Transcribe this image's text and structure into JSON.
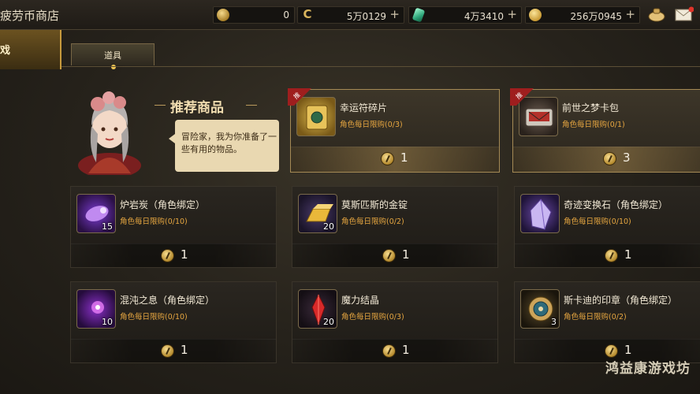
{
  "header": {
    "title": "疲劳币商店",
    "resources": [
      {
        "icon": "fatigue-coin-icon",
        "value": "0"
      },
      {
        "icon": "gold-c-icon",
        "value": "5万0129"
      },
      {
        "icon": "green-gem-icon",
        "value": "4万3410"
      },
      {
        "icon": "gold-coin-icon",
        "value": "256万0945"
      }
    ],
    "plus": "+"
  },
  "side_tab": {
    "label": "戏"
  },
  "tabs": [
    {
      "label": "道具"
    }
  ],
  "recommend": {
    "title": "推荐商品",
    "npc_speech": "冒险家，我为你准备了一些有用的物品。"
  },
  "items": [
    {
      "name": "幸运符碎片",
      "limit": "角色每日限购(0/3)",
      "price": "1",
      "qty": "",
      "featured": true,
      "icon": "lucky-charm-icon"
    },
    {
      "name": "前世之梦卡包",
      "limit": "角色每日限购(0/1)",
      "price": "3",
      "qty": "",
      "featured": true,
      "icon": "card-pack-icon"
    },
    {
      "name": "炉岩炭（角色绑定）",
      "limit": "角色每日限购(0/10)",
      "price": "1",
      "qty": "15",
      "featured": false,
      "icon": "purple-ore-icon"
    },
    {
      "name": "莫斯匹斯的金锭",
      "limit": "角色每日限购(0/2)",
      "price": "1",
      "qty": "20",
      "featured": false,
      "icon": "gold-ingot-icon"
    },
    {
      "name": "奇迹变换石（角色绑定）",
      "limit": "角色每日限购(0/10)",
      "price": "1",
      "qty": "",
      "featured": false,
      "icon": "crystal-icon"
    },
    {
      "name": "混沌之息（角色绑定）",
      "limit": "角色每日限购(0/10)",
      "price": "1",
      "qty": "10",
      "featured": false,
      "icon": "chaos-breath-icon"
    },
    {
      "name": "魔力结晶",
      "limit": "角色每日限购(0/3)",
      "price": "1",
      "qty": "20",
      "featured": false,
      "icon": "red-crystal-icon"
    },
    {
      "name": "斯卡迪的印章（角色绑定）",
      "limit": "角色每日限购(0/2)",
      "price": "1",
      "qty": "3",
      "featured": false,
      "icon": "seal-icon"
    }
  ],
  "badge_text": "推",
  "watermark": "鸿益康游戏坊",
  "colors": {
    "accent": "#e6a640",
    "gold": "#c79a3d",
    "background": "#26221b"
  }
}
